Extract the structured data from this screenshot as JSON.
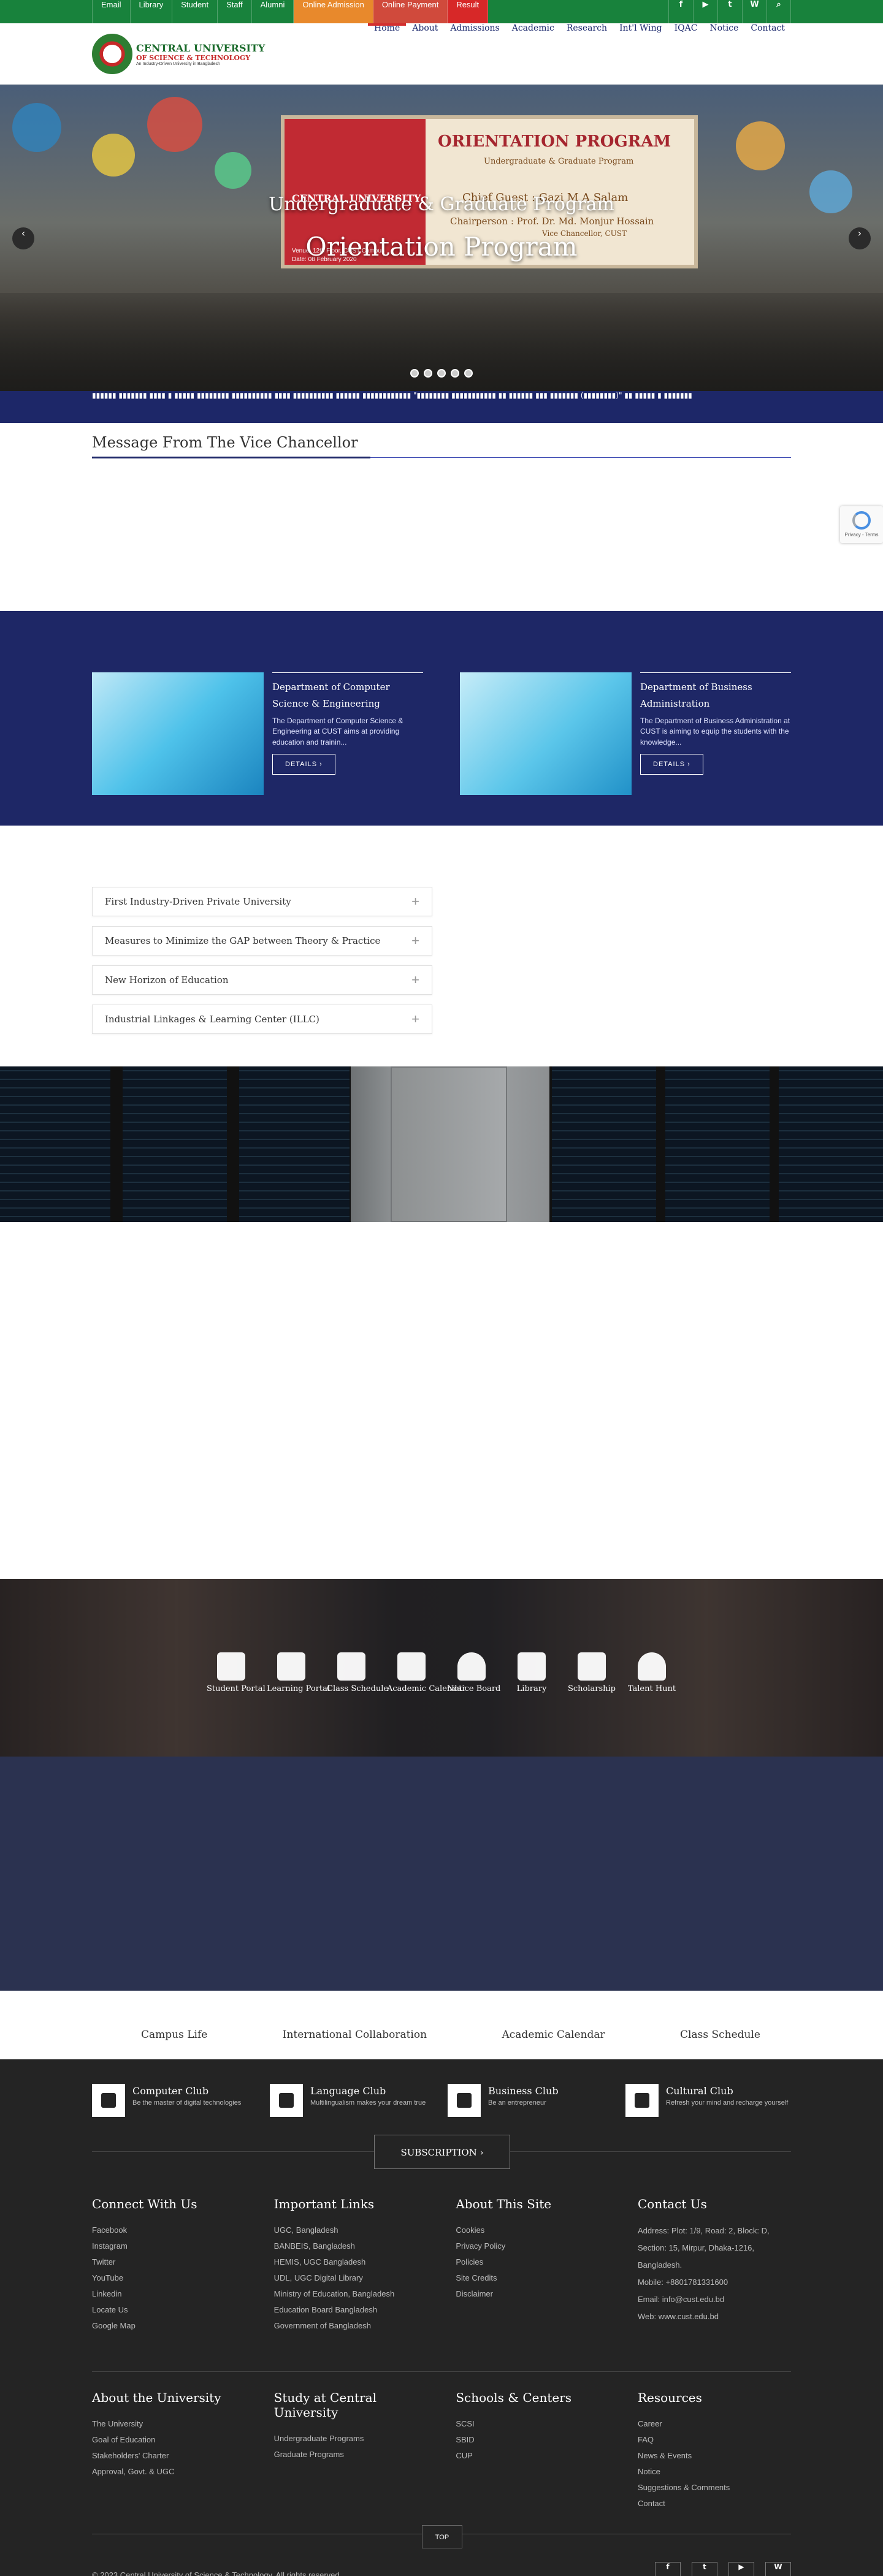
{
  "topbar": {
    "links": [
      "Email",
      "Library",
      "Student",
      "Staff",
      "Alumni",
      "Online Admission",
      "Online Payment",
      "Result"
    ],
    "icons": [
      "f",
      "▶",
      "t",
      "W",
      "⌕"
    ]
  },
  "header": {
    "logo_line1": "CENTRAL UNIVERSITY",
    "logo_line2": "OF SCIENCE & TECHNOLOGY",
    "logo_line3": "An Industry-Driven University in Bangladesh",
    "nav": [
      "Home",
      "About",
      "Admissions",
      "Academic",
      "Research",
      "Int'l Wing",
      "IQAC",
      "Notice",
      "Contact"
    ]
  },
  "hero": {
    "subtitle": "Undergraduate & Graduate Program",
    "title": "Orientation Program",
    "banner_heading": "ORIENTATION PROGRAM",
    "banner_sub": "Undergraduate & Graduate Program",
    "banner_guest": "Chief Guest : Gazi M A Salam",
    "banner_chair": "Chairperson : Prof. Dr. Md. Monjur Hossain",
    "banner_chair_role": "Vice Chancellor, CUST",
    "banner_uni": "CENTRAL UNIVERSITY",
    "banner_venue": "Venue: 12th Floor, CUST Campus",
    "banner_date": "Date: 08 February 2020",
    "prev": "‹",
    "next": "›"
  },
  "ticker": {
    "text": "▮▮▮▮▮▮ ▮▮▮▮▮▮▮ ▮▮▮▮ ▮ ▮▮▮▮▮ ▮▮▮▮▮▮▮▮ ▮▮▮▮▮▮▮▮▮▮ ▮▮▮▮ ▮▮▮▮▮▮▮▮▮▮ ▮▮▮▮▮▮ ▮▮▮▮▮▮▮▮▮▮▮▮ \"▮▮▮▮▮▮▮▮ ▮▮▮▮▮▮▮▮▮▮▮ ▮▮ ▮▮▮▮▮▮ ▮▮▮ ▮▮▮▮▮▮▮ (▮▮▮▮▮▮▮▮)\" ▮▮ ▮▮▮▮▮ ▮ ▮▮▮▮▮▮▮"
  },
  "message": {
    "heading": "Message From The Vice Chancellor"
  },
  "recaptcha": {
    "label": "Privacy - Terms"
  },
  "departments": [
    {
      "title": "Department of Computer Science & Engineering",
      "desc": "The Department of Computer Science & Engineering at CUST aims at providing education and trainin...",
      "button": "DETAILS  ›"
    },
    {
      "title": "Department of Business Administration",
      "desc": "The Department of Business Administration at CUST is aiming to equip the students with the knowledge...",
      "button": "DETAILS  ›"
    }
  ],
  "features": [
    "First Industry-Driven Private University",
    "Measures to Minimize the GAP between Theory & Practice",
    "New Horizon of Education",
    "Industrial Linkages & Learning Center (ILLC)"
  ],
  "quicklinks": [
    "Student Portal",
    "Learning Portal",
    "Class Schedule",
    "Academic Calendar",
    "Notice Board",
    "Library",
    "Scholarship",
    "Talent Hunt"
  ],
  "tabstrip": [
    "Campus Life",
    "International Collaboration",
    "Academic Calendar",
    "Class Schedule"
  ],
  "footer": {
    "clubs": [
      {
        "title": "Computer Club",
        "desc": "Be the master of digital technologies"
      },
      {
        "title": "Language Club",
        "desc": "Multilingualism makes your dream true"
      },
      {
        "title": "Business Club",
        "desc": "Be an entrepreneur"
      },
      {
        "title": "Cultural Club",
        "desc": "Refresh your mind and recharge yourself"
      }
    ],
    "subscription": "SUBSCRIPTION  ›",
    "connect": {
      "title": "Connect With Us",
      "links": [
        "Facebook",
        "Instagram",
        "Twitter",
        "YouTube",
        "Linkedin",
        "Locate Us",
        "Google Map"
      ]
    },
    "important": {
      "title": "Important Links",
      "links": [
        "UGC, Bangladesh",
        "BANBEIS, Bangladesh",
        "HEMIS, UGC Bangladesh",
        "UDL, UGC Digital Library",
        "Ministry of Education, Bangladesh",
        "Education Board Bangladesh",
        "Government of Bangladesh"
      ]
    },
    "about_site": {
      "title": "About This Site",
      "links": [
        "Cookies",
        "Privacy Policy",
        "Policies",
        "Site Credits",
        "Disclaimer"
      ]
    },
    "contact": {
      "title": "Contact Us",
      "address": "Address: Plot: 1/9, Road: 2, Block: D, Section: 15, Mirpur, Dhaka-1216, Bangladesh.",
      "mobile": "Mobile: +8801781331600",
      "email": "Email: info@cust.edu.bd",
      "web": "Web: www.cust.edu.bd"
    },
    "about_uni": {
      "title": "About the University",
      "links": [
        "The University",
        "Goal of Education",
        "Stakeholders' Charter",
        "Approval, Govt. & UGC"
      ]
    },
    "study": {
      "title": "Study at Central University",
      "links": [
        "Undergraduate Programs",
        "Graduate Programs"
      ]
    },
    "schools": {
      "title": "Schools & Centers",
      "links": [
        "SCSI",
        "SBID",
        "CUP"
      ]
    },
    "resources": {
      "title": "Resources",
      "links": [
        "Career",
        "FAQ",
        "News & Events",
        "Notice",
        "Suggestions & Comments",
        "Contact"
      ]
    },
    "top": "TOP",
    "copyright": "© 2023 Central University of Science & Technology. All rights reserved.",
    "social": [
      "f",
      "t",
      "▶",
      "W"
    ]
  }
}
